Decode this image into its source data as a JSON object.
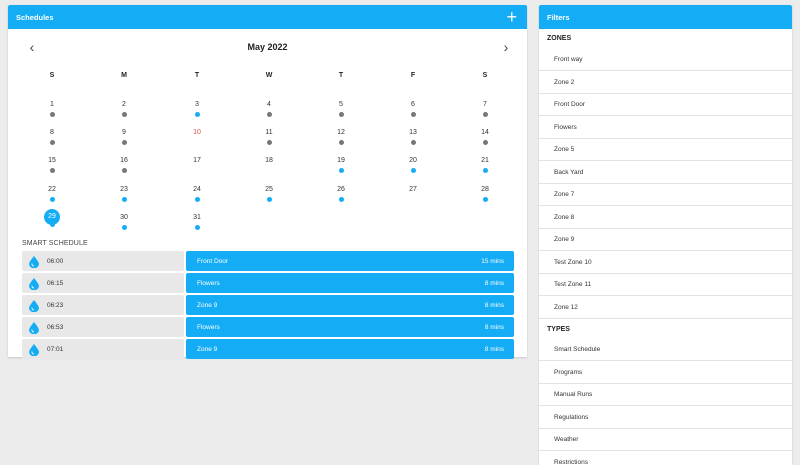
{
  "schedules": {
    "title": "Schedules",
    "add_icon": "plus-icon",
    "calendar": {
      "month_title": "May 2022",
      "prev_icon": "chevron-left-icon",
      "next_icon": "chevron-right-icon",
      "weekdays": [
        "S",
        "M",
        "T",
        "W",
        "T",
        "F",
        "S"
      ],
      "days": [
        {
          "day": "1",
          "dot": "gray"
        },
        {
          "day": "2",
          "dot": "gray"
        },
        {
          "day": "3",
          "dot": "blue"
        },
        {
          "day": "4",
          "dot": "gray"
        },
        {
          "day": "5",
          "dot": "gray"
        },
        {
          "day": "6",
          "dot": "gray"
        },
        {
          "day": "7",
          "dot": "gray"
        },
        {
          "day": "8",
          "dot": "gray"
        },
        {
          "day": "9",
          "dot": "gray"
        },
        {
          "day": "10",
          "dot": "none",
          "red": true
        },
        {
          "day": "11",
          "dot": "gray"
        },
        {
          "day": "12",
          "dot": "gray"
        },
        {
          "day": "13",
          "dot": "gray"
        },
        {
          "day": "14",
          "dot": "gray"
        },
        {
          "day": "15",
          "dot": "gray"
        },
        {
          "day": "16",
          "dot": "gray"
        },
        {
          "day": "17",
          "dot": "none"
        },
        {
          "day": "18",
          "dot": "none"
        },
        {
          "day": "19",
          "dot": "blue"
        },
        {
          "day": "20",
          "dot": "blue"
        },
        {
          "day": "21",
          "dot": "blue"
        },
        {
          "day": "22",
          "dot": "blue"
        },
        {
          "day": "23",
          "dot": "blue"
        },
        {
          "day": "24",
          "dot": "blue"
        },
        {
          "day": "25",
          "dot": "blue"
        },
        {
          "day": "26",
          "dot": "blue"
        },
        {
          "day": "27",
          "dot": "none"
        },
        {
          "day": "28",
          "dot": "blue"
        },
        {
          "day": "29",
          "dot": "blue",
          "selected": true
        },
        {
          "day": "30",
          "dot": "blue"
        },
        {
          "day": "31",
          "dot": "blue"
        }
      ]
    },
    "smart_schedule": {
      "label": "SMART SCHEDULE",
      "rows": [
        {
          "time": "06:00",
          "zone": "Front Door",
          "duration": "15 mins"
        },
        {
          "time": "06:15",
          "zone": "Flowers",
          "duration": "8 mins"
        },
        {
          "time": "06:23",
          "zone": "Zone 9",
          "duration": "8 mins"
        },
        {
          "time": "06:53",
          "zone": "Flowers",
          "duration": "8 mins"
        },
        {
          "time": "07:01",
          "zone": "Zone 9",
          "duration": "8 mins"
        }
      ]
    }
  },
  "filters": {
    "title": "Filters",
    "zones_label": "ZONES",
    "zones": [
      "Front way",
      "Zone 2",
      "Front Door",
      "Flowers",
      "Zone 5",
      "Back Yard",
      "Zone 7",
      "Zone 8",
      "Zone 9",
      "Test Zone 10",
      "Test Zone 11",
      "Zone 12"
    ],
    "types_label": "TYPES",
    "types": [
      "Smart Schedule",
      "Programs",
      "Manual Runs",
      "Regulations",
      "Weather",
      "Restrictions"
    ]
  },
  "colors": {
    "accent": "#14adf5",
    "dot_gray": "#777777",
    "today_red": "#e04e4e"
  }
}
